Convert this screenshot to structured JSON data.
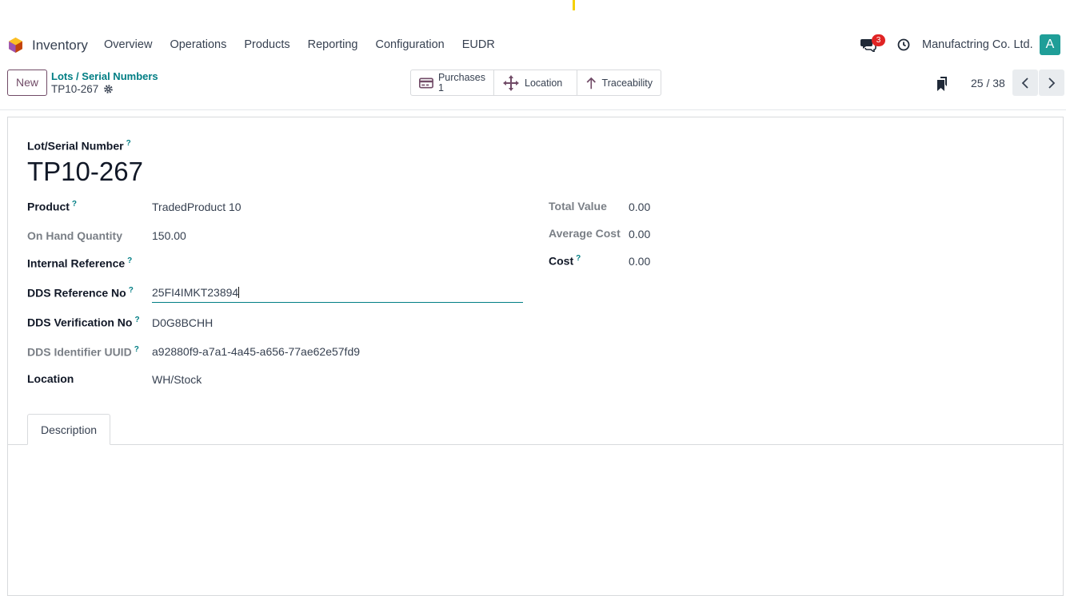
{
  "navbar": {
    "app_name": "Inventory",
    "menu": [
      "Overview",
      "Operations",
      "Products",
      "Reporting",
      "Configuration",
      "EUDR"
    ],
    "chat_count": "3",
    "company": "Manufactring Co. Ltd.",
    "avatar_letter": "A"
  },
  "control": {
    "new_label": "New",
    "breadcrumb": "Lots / Serial Numbers",
    "record": "TP10-267",
    "smart": {
      "purchases_label": "Purchases",
      "purchases_count": "1",
      "location_label": "Location",
      "traceability_label": "Traceability"
    },
    "pager": "25 / 38"
  },
  "form": {
    "title_label": "Lot/Serial Number",
    "help": "?",
    "name": "TP10-267",
    "fields": {
      "product_label": "Product",
      "product_value": "TradedProduct 10",
      "onhand_label": "On Hand Quantity",
      "onhand_value": "150.00",
      "internal_ref_label": "Internal Reference",
      "internal_ref_value": "",
      "dds_ref_label": "DDS Reference No",
      "dds_ref_value": "25FI4IMKT23894",
      "dds_ver_label": "DDS Verification No",
      "dds_ver_value": "D0G8BCHH",
      "dds_uuid_label": "DDS Identifier UUID",
      "dds_uuid_value": "a92880f9-a7a1-4a45-a656-77ae62e57fd9",
      "location_label": "Location",
      "location_value": "WH/Stock"
    },
    "right": {
      "total_value_label": "Total Value",
      "total_value": "0.00",
      "avg_cost_label": "Average Cost",
      "avg_cost": "0.00",
      "cost_label": "Cost",
      "cost": "0.00"
    },
    "tab_label": "Description"
  },
  "colors": {
    "primary": "#714b67",
    "teal": "#017e84",
    "badge": "#e02424",
    "avatar": "#1f9e98"
  }
}
